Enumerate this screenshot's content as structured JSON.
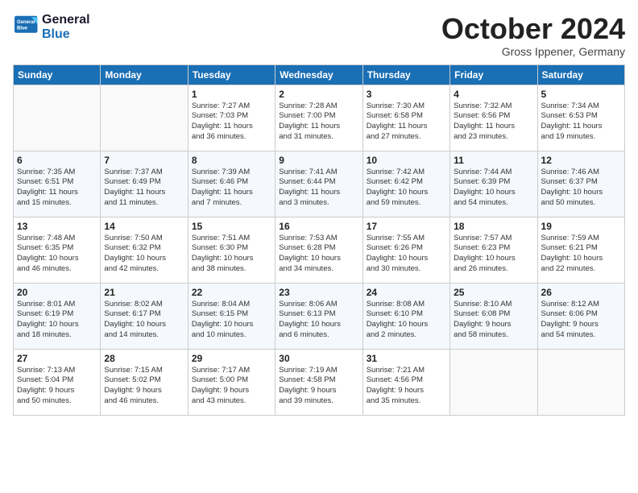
{
  "logo": {
    "line1": "General",
    "line2": "Blue"
  },
  "title": "October 2024",
  "location": "Gross Ippener, Germany",
  "headers": [
    "Sunday",
    "Monday",
    "Tuesday",
    "Wednesday",
    "Thursday",
    "Friday",
    "Saturday"
  ],
  "weeks": [
    [
      {
        "day": "",
        "info": ""
      },
      {
        "day": "",
        "info": ""
      },
      {
        "day": "1",
        "info": "Sunrise: 7:27 AM\nSunset: 7:03 PM\nDaylight: 11 hours\nand 36 minutes."
      },
      {
        "day": "2",
        "info": "Sunrise: 7:28 AM\nSunset: 7:00 PM\nDaylight: 11 hours\nand 31 minutes."
      },
      {
        "day": "3",
        "info": "Sunrise: 7:30 AM\nSunset: 6:58 PM\nDaylight: 11 hours\nand 27 minutes."
      },
      {
        "day": "4",
        "info": "Sunrise: 7:32 AM\nSunset: 6:56 PM\nDaylight: 11 hours\nand 23 minutes."
      },
      {
        "day": "5",
        "info": "Sunrise: 7:34 AM\nSunset: 6:53 PM\nDaylight: 11 hours\nand 19 minutes."
      }
    ],
    [
      {
        "day": "6",
        "info": "Sunrise: 7:35 AM\nSunset: 6:51 PM\nDaylight: 11 hours\nand 15 minutes."
      },
      {
        "day": "7",
        "info": "Sunrise: 7:37 AM\nSunset: 6:49 PM\nDaylight: 11 hours\nand 11 minutes."
      },
      {
        "day": "8",
        "info": "Sunrise: 7:39 AM\nSunset: 6:46 PM\nDaylight: 11 hours\nand 7 minutes."
      },
      {
        "day": "9",
        "info": "Sunrise: 7:41 AM\nSunset: 6:44 PM\nDaylight: 11 hours\nand 3 minutes."
      },
      {
        "day": "10",
        "info": "Sunrise: 7:42 AM\nSunset: 6:42 PM\nDaylight: 10 hours\nand 59 minutes."
      },
      {
        "day": "11",
        "info": "Sunrise: 7:44 AM\nSunset: 6:39 PM\nDaylight: 10 hours\nand 54 minutes."
      },
      {
        "day": "12",
        "info": "Sunrise: 7:46 AM\nSunset: 6:37 PM\nDaylight: 10 hours\nand 50 minutes."
      }
    ],
    [
      {
        "day": "13",
        "info": "Sunrise: 7:48 AM\nSunset: 6:35 PM\nDaylight: 10 hours\nand 46 minutes."
      },
      {
        "day": "14",
        "info": "Sunrise: 7:50 AM\nSunset: 6:32 PM\nDaylight: 10 hours\nand 42 minutes."
      },
      {
        "day": "15",
        "info": "Sunrise: 7:51 AM\nSunset: 6:30 PM\nDaylight: 10 hours\nand 38 minutes."
      },
      {
        "day": "16",
        "info": "Sunrise: 7:53 AM\nSunset: 6:28 PM\nDaylight: 10 hours\nand 34 minutes."
      },
      {
        "day": "17",
        "info": "Sunrise: 7:55 AM\nSunset: 6:26 PM\nDaylight: 10 hours\nand 30 minutes."
      },
      {
        "day": "18",
        "info": "Sunrise: 7:57 AM\nSunset: 6:23 PM\nDaylight: 10 hours\nand 26 minutes."
      },
      {
        "day": "19",
        "info": "Sunrise: 7:59 AM\nSunset: 6:21 PM\nDaylight: 10 hours\nand 22 minutes."
      }
    ],
    [
      {
        "day": "20",
        "info": "Sunrise: 8:01 AM\nSunset: 6:19 PM\nDaylight: 10 hours\nand 18 minutes."
      },
      {
        "day": "21",
        "info": "Sunrise: 8:02 AM\nSunset: 6:17 PM\nDaylight: 10 hours\nand 14 minutes."
      },
      {
        "day": "22",
        "info": "Sunrise: 8:04 AM\nSunset: 6:15 PM\nDaylight: 10 hours\nand 10 minutes."
      },
      {
        "day": "23",
        "info": "Sunrise: 8:06 AM\nSunset: 6:13 PM\nDaylight: 10 hours\nand 6 minutes."
      },
      {
        "day": "24",
        "info": "Sunrise: 8:08 AM\nSunset: 6:10 PM\nDaylight: 10 hours\nand 2 minutes."
      },
      {
        "day": "25",
        "info": "Sunrise: 8:10 AM\nSunset: 6:08 PM\nDaylight: 9 hours\nand 58 minutes."
      },
      {
        "day": "26",
        "info": "Sunrise: 8:12 AM\nSunset: 6:06 PM\nDaylight: 9 hours\nand 54 minutes."
      }
    ],
    [
      {
        "day": "27",
        "info": "Sunrise: 7:13 AM\nSunset: 5:04 PM\nDaylight: 9 hours\nand 50 minutes."
      },
      {
        "day": "28",
        "info": "Sunrise: 7:15 AM\nSunset: 5:02 PM\nDaylight: 9 hours\nand 46 minutes."
      },
      {
        "day": "29",
        "info": "Sunrise: 7:17 AM\nSunset: 5:00 PM\nDaylight: 9 hours\nand 43 minutes."
      },
      {
        "day": "30",
        "info": "Sunrise: 7:19 AM\nSunset: 4:58 PM\nDaylight: 9 hours\nand 39 minutes."
      },
      {
        "day": "31",
        "info": "Sunrise: 7:21 AM\nSunset: 4:56 PM\nDaylight: 9 hours\nand 35 minutes."
      },
      {
        "day": "",
        "info": ""
      },
      {
        "day": "",
        "info": ""
      }
    ]
  ]
}
